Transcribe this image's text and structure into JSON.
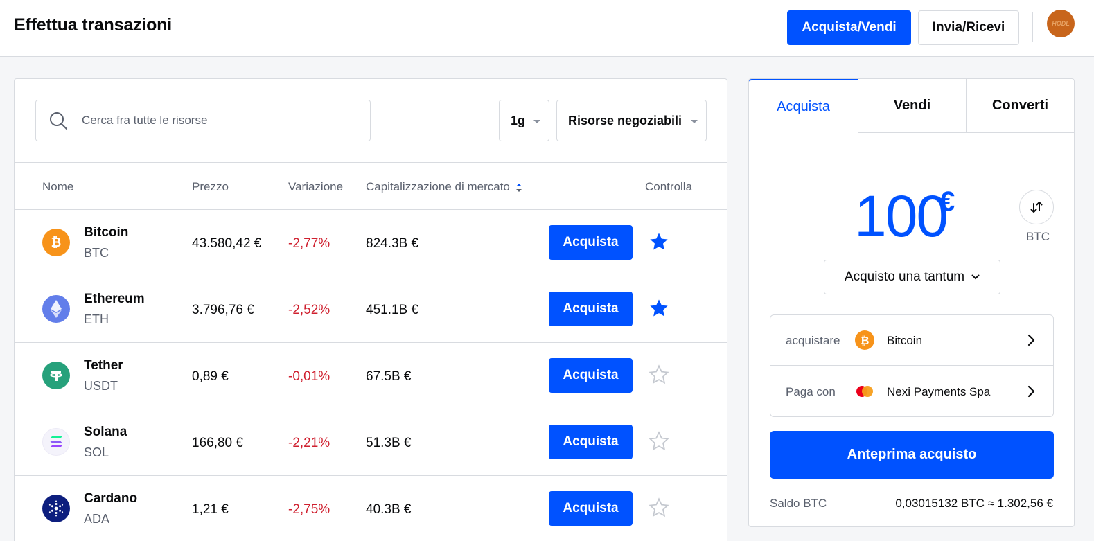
{
  "header": {
    "title": "Effettua transazioni",
    "buy_sell_label": "Acquista/Vendi",
    "send_receive_label": "Invia/Ricevi",
    "avatar_text": "HODL"
  },
  "search": {
    "placeholder": "Cerca fra tutte le risorse"
  },
  "filters": {
    "period": "1g",
    "assets": "Risorse negoziabili"
  },
  "table": {
    "headers": {
      "name": "Nome",
      "price": "Prezzo",
      "change": "Variazione",
      "market_cap": "Capitalizzazione di mercato",
      "watch": "Controlla"
    },
    "buy_label": "Acquista",
    "rows": [
      {
        "name": "Bitcoin",
        "symbol": "BTC",
        "price": "43.580,42 €",
        "change": "-2,77%",
        "market_cap": "824.3B €",
        "watched": true,
        "icon": "bitcoin-icon",
        "color": "#f7931a"
      },
      {
        "name": "Ethereum",
        "symbol": "ETH",
        "price": "3.796,76 €",
        "change": "-2,52%",
        "market_cap": "451.1B €",
        "watched": true,
        "icon": "ethereum-icon",
        "color": "#627eea"
      },
      {
        "name": "Tether",
        "symbol": "USDT",
        "price": "0,89 €",
        "change": "-0,01%",
        "market_cap": "67.5B €",
        "watched": false,
        "icon": "tether-icon",
        "color": "#26a17b"
      },
      {
        "name": "Solana",
        "symbol": "SOL",
        "price": "166,80 €",
        "change": "-2,21%",
        "market_cap": "51.3B €",
        "watched": false,
        "icon": "solana-icon",
        "color": "#9945ff"
      },
      {
        "name": "Cardano",
        "symbol": "ADA",
        "price": "1,21 €",
        "change": "-2,75%",
        "market_cap": "40.3B €",
        "watched": false,
        "icon": "cardano-icon",
        "color": "#0d1e7e"
      }
    ]
  },
  "trade": {
    "tabs": [
      "Acquista",
      "Vendi",
      "Converti"
    ],
    "amount": "100",
    "currency": "€",
    "swap_unit": "BTC",
    "frequency": "Acquisto una tantum",
    "buy_label": "acquistare",
    "buy_asset": "Bitcoin",
    "pay_label": "Paga con",
    "pay_method": "Nexi Payments Spa",
    "preview_label": "Anteprima acquisto",
    "balance_label": "Saldo BTC",
    "balance_value": "0,03015132 BTC ≈ 1.302,56 €"
  },
  "colors": {
    "accent": "#0052ff",
    "negative": "#cf202f",
    "border": "#d8dbe0"
  }
}
